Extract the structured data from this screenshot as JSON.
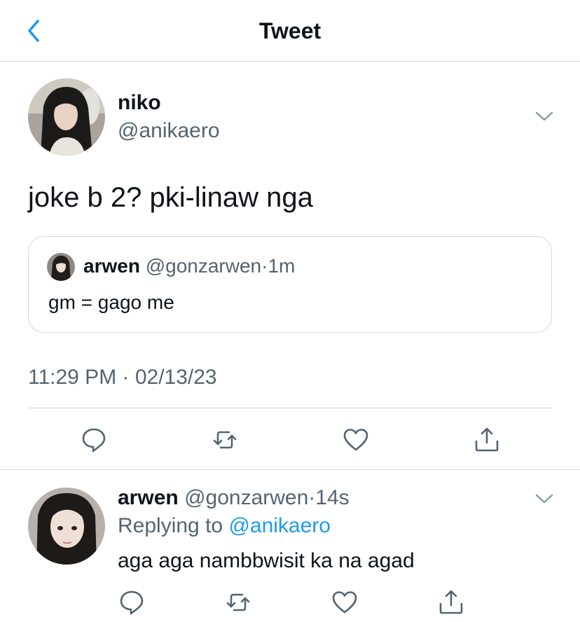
{
  "header": {
    "title": "Tweet",
    "back_icon": "chevron-left-icon"
  },
  "main_tweet": {
    "author_name": "niko",
    "author_handle": "@anikaero",
    "text": "joke b 2? pki-linaw nga",
    "timestamp": "11:29 PM · 02/13/23",
    "quoted": {
      "author_name": "arwen",
      "author_handle": "@gonzarwen",
      "separator": "·",
      "age": "1m",
      "text": "gm = gago me"
    },
    "actions": [
      "reply-icon",
      "retweet-icon",
      "like-icon",
      "share-icon"
    ]
  },
  "reply": {
    "author_name": "arwen",
    "author_handle": "@gonzarwen",
    "separator": "·",
    "age": "14s",
    "replying_label": "Replying to",
    "replying_to": "@anikaero",
    "text": "aga aga nambbwisit ka na agad"
  },
  "colors": {
    "accent": "#1d9bf0",
    "text": "#0f1419",
    "secondary": "#536471",
    "border": "#cfd9de"
  }
}
